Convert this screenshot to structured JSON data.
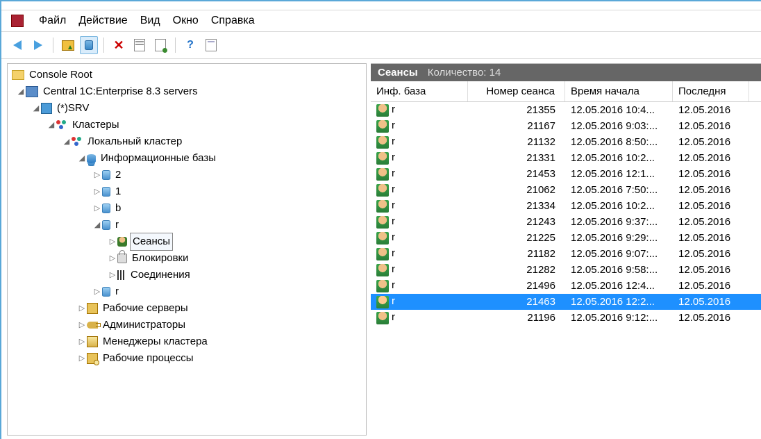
{
  "menu": {
    "file": "Файл",
    "action": "Действие",
    "view": "Вид",
    "window": "Окно",
    "help": "Справка"
  },
  "tree": {
    "root": "Console Root",
    "central": "Central 1C:Enterprise 8.3 servers",
    "srv": "(*)SRV",
    "clusters": "Кластеры",
    "local": "Локальный кластер",
    "infobases": "Информационные базы",
    "db1": "2",
    "db2": "1",
    "db3": "b",
    "db4": "r",
    "db5": "r",
    "sessions": "Сеансы",
    "locks": "Блокировки",
    "connections": "Соединения",
    "workservers": "Рабочие серверы",
    "admins": "Администраторы",
    "managers": "Менеджеры кластера",
    "processes": "Рабочие процессы"
  },
  "right": {
    "title": "Сеансы",
    "countLabel": "Количество: 14",
    "cols": {
      "c0": "Инф. база",
      "c1": "Номер сеанса",
      "c2": "Время начала",
      "c3": "Последня"
    }
  },
  "rows": [
    {
      "base": "r",
      "num": "21355",
      "start": "12.05.2016 10:4...",
      "last": "12.05.2016"
    },
    {
      "base": "r",
      "num": "21167",
      "start": "12.05.2016 9:03:...",
      "last": "12.05.2016"
    },
    {
      "base": "r",
      "num": "21132",
      "start": "12.05.2016 8:50:...",
      "last": "12.05.2016"
    },
    {
      "base": "r",
      "num": "21331",
      "start": "12.05.2016 10:2...",
      "last": "12.05.2016"
    },
    {
      "base": "r",
      "num": "21453",
      "start": "12.05.2016 12:1...",
      "last": "12.05.2016"
    },
    {
      "base": "r",
      "num": "21062",
      "start": "12.05.2016 7:50:...",
      "last": "12.05.2016"
    },
    {
      "base": "r",
      "num": "21334",
      "start": "12.05.2016 10:2...",
      "last": "12.05.2016"
    },
    {
      "base": "r",
      "num": "21243",
      "start": "12.05.2016 9:37:...",
      "last": "12.05.2016"
    },
    {
      "base": "r",
      "num": "21225",
      "start": "12.05.2016 9:29:...",
      "last": "12.05.2016"
    },
    {
      "base": "r",
      "num": "21182",
      "start": "12.05.2016 9:07:...",
      "last": "12.05.2016"
    },
    {
      "base": "r",
      "num": "21282",
      "start": "12.05.2016 9:58:...",
      "last": "12.05.2016"
    },
    {
      "base": "r",
      "num": "21496",
      "start": "12.05.2016 12:4...",
      "last": "12.05.2016"
    },
    {
      "base": "r",
      "num": "21463",
      "start": "12.05.2016 12:2...",
      "last": "12.05.2016",
      "sel": true
    },
    {
      "base": "r",
      "num": "21196",
      "start": "12.05.2016 9:12:...",
      "last": "12.05.2016"
    }
  ]
}
